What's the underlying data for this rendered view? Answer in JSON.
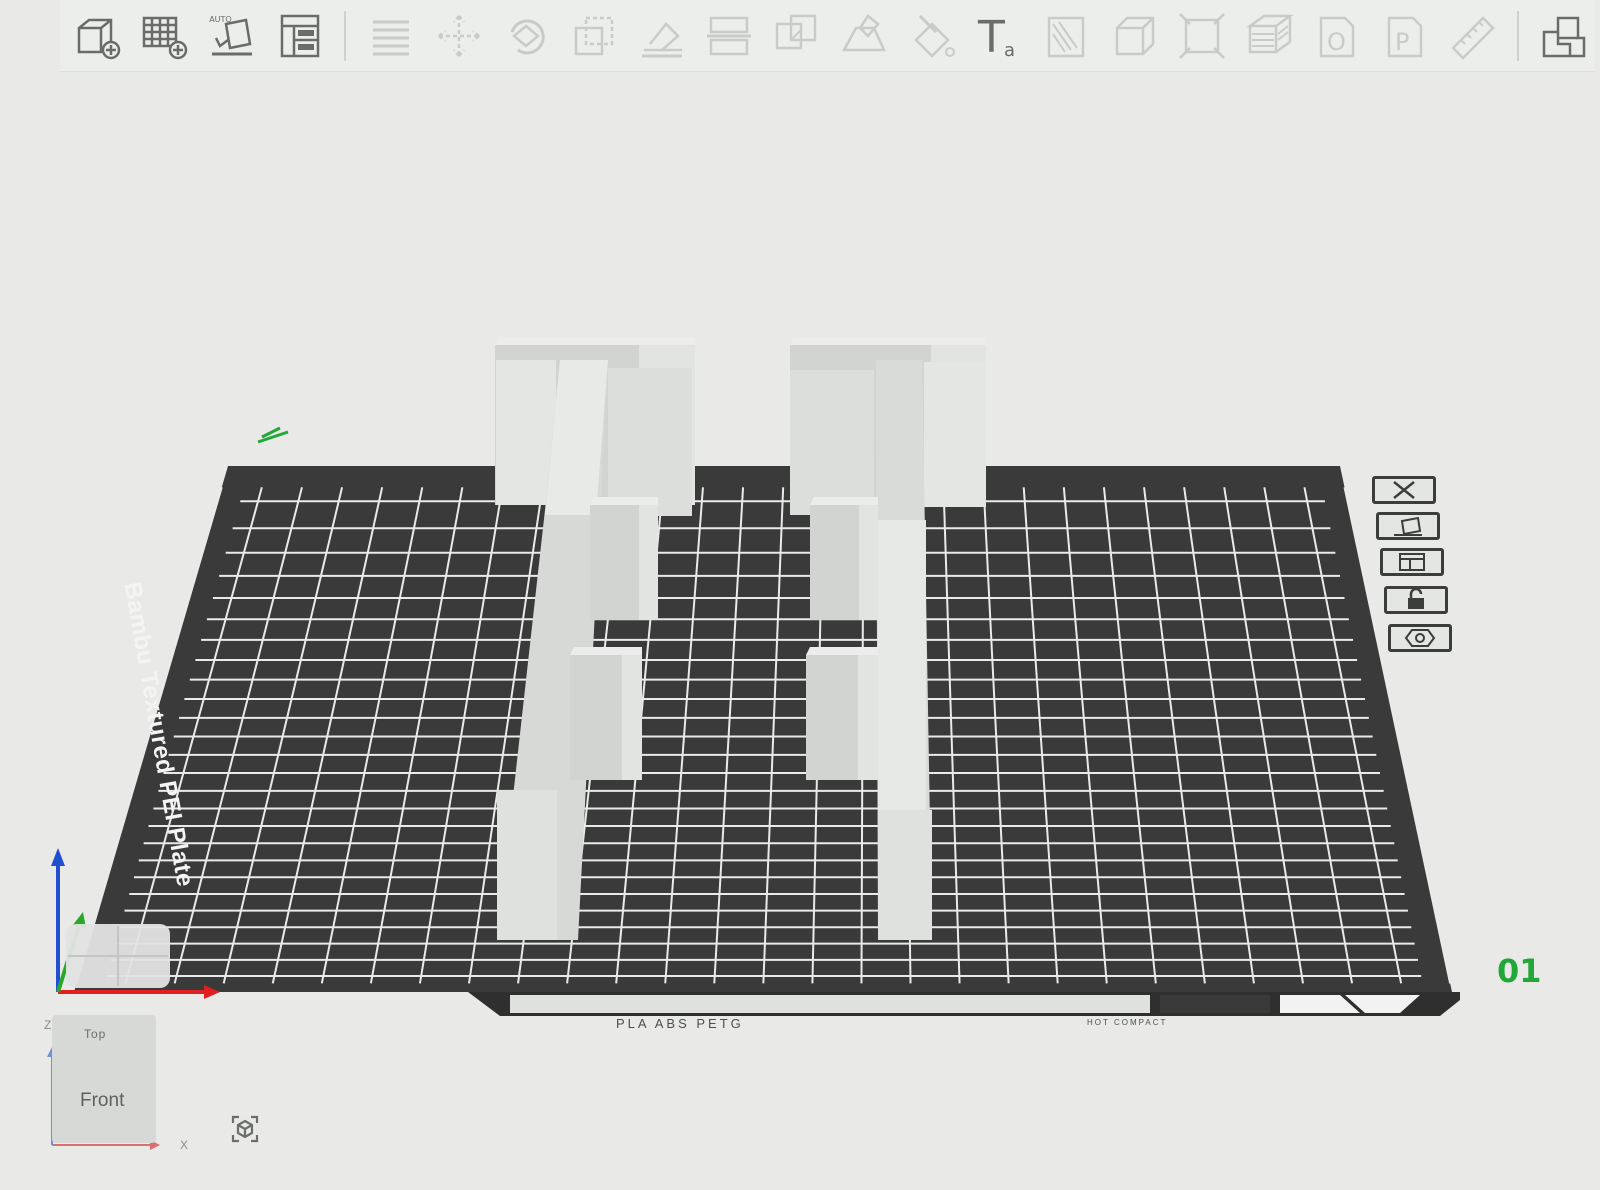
{
  "toolbar": {
    "buttons": [
      {
        "icon": "add-cube-icon",
        "enabled": true
      },
      {
        "icon": "add-plate-icon",
        "enabled": true
      },
      {
        "icon": "auto-orient-icon",
        "enabled": true,
        "badge": "AUTO"
      },
      {
        "icon": "arrange-icon",
        "enabled": true
      },
      {
        "icon": "split-plates-icon",
        "enabled": false
      },
      {
        "icon": "move-icon",
        "enabled": false
      },
      {
        "icon": "rotate-icon",
        "enabled": false
      },
      {
        "icon": "scale-icon",
        "enabled": false
      },
      {
        "icon": "lay-on-face-icon",
        "enabled": false
      },
      {
        "icon": "cut-icon",
        "enabled": false
      },
      {
        "icon": "boolean-icon",
        "enabled": false
      },
      {
        "icon": "support-paint-icon",
        "enabled": false
      },
      {
        "icon": "color-paint-icon",
        "enabled": false
      },
      {
        "icon": "text-icon",
        "enabled": true
      },
      {
        "icon": "measure-icon",
        "enabled": false
      },
      {
        "icon": "assembly-icon",
        "enabled": false
      },
      {
        "icon": "fit-to-plate-icon",
        "enabled": false
      },
      {
        "icon": "variable-layer-icon",
        "enabled": false
      },
      {
        "icon": "object-o-icon",
        "enabled": false
      },
      {
        "icon": "object-p-icon",
        "enabled": false
      },
      {
        "icon": "ruler-icon",
        "enabled": false
      },
      {
        "icon": "assemble-view-icon",
        "enabled": true
      }
    ],
    "text_glyph": "T",
    "text_sub": "a",
    "o_glyph": "O",
    "p_glyph": "P"
  },
  "plate": {
    "label": "Bambu Textured PEI Plate",
    "number": "01",
    "strip_materials": "PLA  ABS  PETG",
    "strip_hot_compact": "HOT COMPACT"
  },
  "plate_tools": [
    {
      "icon": "delete-plate-icon"
    },
    {
      "icon": "orient-plate-icon"
    },
    {
      "icon": "arrange-plate-icon"
    },
    {
      "icon": "lock-plate-icon"
    },
    {
      "icon": "plate-settings-icon"
    }
  ],
  "navigator": {
    "top_label": "Top",
    "front_label": "Front",
    "z_label": "Z",
    "x_label": "X"
  },
  "colors": {
    "background": "#e9eae8",
    "plate": "#3a3a3a",
    "grid": "#eaeaea",
    "model": "#d6d8d6",
    "plate_number": "#21a838",
    "axis_x": "#e02020",
    "axis_y": "#2aa82a",
    "axis_z": "#2050d0"
  }
}
